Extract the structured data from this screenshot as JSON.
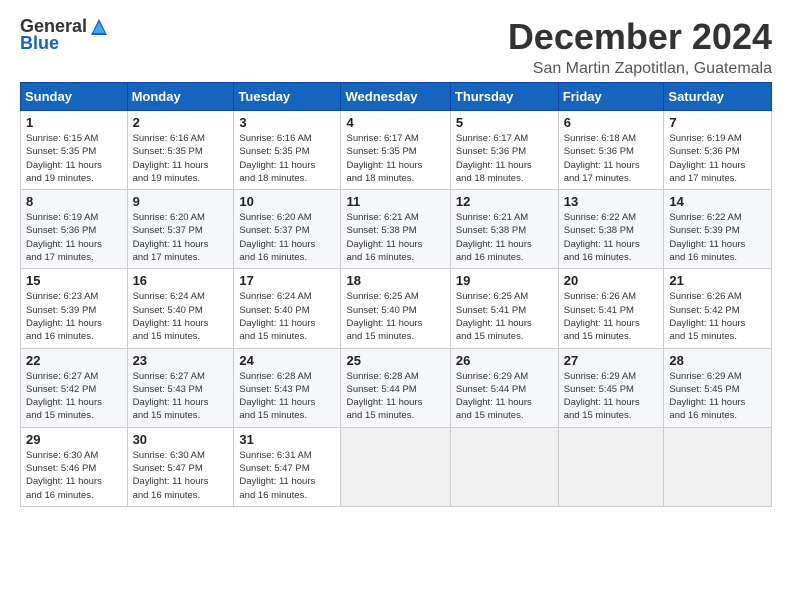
{
  "logo": {
    "general": "General",
    "blue": "Blue"
  },
  "title": "December 2024",
  "location": "San Martin Zapotitlan, Guatemala",
  "days_header": [
    "Sunday",
    "Monday",
    "Tuesday",
    "Wednesday",
    "Thursday",
    "Friday",
    "Saturday"
  ],
  "weeks": [
    [
      {
        "day": "1",
        "sunrise": "6:15 AM",
        "sunset": "5:35 PM",
        "daylight": "11 hours and 19 minutes."
      },
      {
        "day": "2",
        "sunrise": "6:16 AM",
        "sunset": "5:35 PM",
        "daylight": "11 hours and 19 minutes."
      },
      {
        "day": "3",
        "sunrise": "6:16 AM",
        "sunset": "5:35 PM",
        "daylight": "11 hours and 18 minutes."
      },
      {
        "day": "4",
        "sunrise": "6:17 AM",
        "sunset": "5:35 PM",
        "daylight": "11 hours and 18 minutes."
      },
      {
        "day": "5",
        "sunrise": "6:17 AM",
        "sunset": "5:36 PM",
        "daylight": "11 hours and 18 minutes."
      },
      {
        "day": "6",
        "sunrise": "6:18 AM",
        "sunset": "5:36 PM",
        "daylight": "11 hours and 17 minutes."
      },
      {
        "day": "7",
        "sunrise": "6:19 AM",
        "sunset": "5:36 PM",
        "daylight": "11 hours and 17 minutes."
      }
    ],
    [
      {
        "day": "8",
        "sunrise": "6:19 AM",
        "sunset": "5:36 PM",
        "daylight": "11 hours and 17 minutes."
      },
      {
        "day": "9",
        "sunrise": "6:20 AM",
        "sunset": "5:37 PM",
        "daylight": "11 hours and 17 minutes."
      },
      {
        "day": "10",
        "sunrise": "6:20 AM",
        "sunset": "5:37 PM",
        "daylight": "11 hours and 16 minutes."
      },
      {
        "day": "11",
        "sunrise": "6:21 AM",
        "sunset": "5:38 PM",
        "daylight": "11 hours and 16 minutes."
      },
      {
        "day": "12",
        "sunrise": "6:21 AM",
        "sunset": "5:38 PM",
        "daylight": "11 hours and 16 minutes."
      },
      {
        "day": "13",
        "sunrise": "6:22 AM",
        "sunset": "5:38 PM",
        "daylight": "11 hours and 16 minutes."
      },
      {
        "day": "14",
        "sunrise": "6:22 AM",
        "sunset": "5:39 PM",
        "daylight": "11 hours and 16 minutes."
      }
    ],
    [
      {
        "day": "15",
        "sunrise": "6:23 AM",
        "sunset": "5:39 PM",
        "daylight": "11 hours and 16 minutes."
      },
      {
        "day": "16",
        "sunrise": "6:24 AM",
        "sunset": "5:40 PM",
        "daylight": "11 hours and 15 minutes."
      },
      {
        "day": "17",
        "sunrise": "6:24 AM",
        "sunset": "5:40 PM",
        "daylight": "11 hours and 15 minutes."
      },
      {
        "day": "18",
        "sunrise": "6:25 AM",
        "sunset": "5:40 PM",
        "daylight": "11 hours and 15 minutes."
      },
      {
        "day": "19",
        "sunrise": "6:25 AM",
        "sunset": "5:41 PM",
        "daylight": "11 hours and 15 minutes."
      },
      {
        "day": "20",
        "sunrise": "6:26 AM",
        "sunset": "5:41 PM",
        "daylight": "11 hours and 15 minutes."
      },
      {
        "day": "21",
        "sunrise": "6:26 AM",
        "sunset": "5:42 PM",
        "daylight": "11 hours and 15 minutes."
      }
    ],
    [
      {
        "day": "22",
        "sunrise": "6:27 AM",
        "sunset": "5:42 PM",
        "daylight": "11 hours and 15 minutes."
      },
      {
        "day": "23",
        "sunrise": "6:27 AM",
        "sunset": "5:43 PM",
        "daylight": "11 hours and 15 minutes."
      },
      {
        "day": "24",
        "sunrise": "6:28 AM",
        "sunset": "5:43 PM",
        "daylight": "11 hours and 15 minutes."
      },
      {
        "day": "25",
        "sunrise": "6:28 AM",
        "sunset": "5:44 PM",
        "daylight": "11 hours and 15 minutes."
      },
      {
        "day": "26",
        "sunrise": "6:29 AM",
        "sunset": "5:44 PM",
        "daylight": "11 hours and 15 minutes."
      },
      {
        "day": "27",
        "sunrise": "6:29 AM",
        "sunset": "5:45 PM",
        "daylight": "11 hours and 15 minutes."
      },
      {
        "day": "28",
        "sunrise": "6:29 AM",
        "sunset": "5:45 PM",
        "daylight": "11 hours and 16 minutes."
      }
    ],
    [
      {
        "day": "29",
        "sunrise": "6:30 AM",
        "sunset": "5:46 PM",
        "daylight": "11 hours and 16 minutes."
      },
      {
        "day": "30",
        "sunrise": "6:30 AM",
        "sunset": "5:47 PM",
        "daylight": "11 hours and 16 minutes."
      },
      {
        "day": "31",
        "sunrise": "6:31 AM",
        "sunset": "5:47 PM",
        "daylight": "11 hours and 16 minutes."
      },
      null,
      null,
      null,
      null
    ]
  ]
}
